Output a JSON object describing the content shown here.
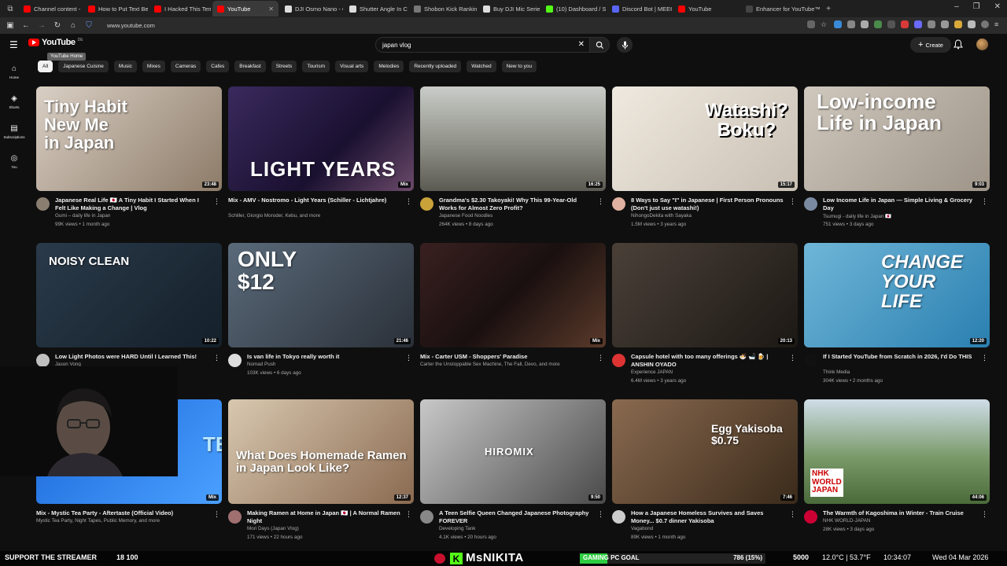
{
  "browser": {
    "tabs": [
      {
        "label": "Channel content - Y",
        "color": "#ff0000"
      },
      {
        "label": "How to Put Text Beh",
        "color": "#ff0000"
      },
      {
        "label": "I Hacked This Temu",
        "color": "#ff0000"
      },
      {
        "label": "YouTube",
        "color": "#ff0000",
        "active": true
      },
      {
        "label": "DJI Osmo Nano - Gi",
        "color": "#dddddd"
      },
      {
        "label": "Shutter Angle In Cin",
        "color": "#dddddd"
      },
      {
        "label": "Shobon Kick Ranking",
        "color": "#777777"
      },
      {
        "label": "Buy DJI Mic Series C",
        "color": "#dddddd"
      },
      {
        "label": "(10) Dashboard / Str",
        "color": "#53fc18"
      },
      {
        "label": "Discord Bot | MEE6",
        "color": "#5865f2"
      },
      {
        "label": "YouTube",
        "color": "#ff0000"
      },
      {
        "label": "Enhancer for YouTube™",
        "color": "#444444"
      }
    ],
    "url": "www.youtube.com"
  },
  "header": {
    "logo_text": "YouTube",
    "logo_cc": "DE",
    "tooltip": "YouTube Home",
    "search_value": "japan vlog",
    "create_label": "Create"
  },
  "sidebar": [
    {
      "label": "Home",
      "icon": "home-icon"
    },
    {
      "label": "Shorts",
      "icon": "shorts-icon"
    },
    {
      "label": "Subscriptions",
      "icon": "subscriptions-icon"
    },
    {
      "label": "You",
      "icon": "you-icon"
    }
  ],
  "chips": [
    "All",
    "Japanese Cuisine",
    "Music",
    "Mixes",
    "Cameras",
    "Cafes",
    "Breakfast",
    "Streets",
    "Tourism",
    "Visual arts",
    "Melodies",
    "Recently uploaded",
    "Watched",
    "New to you"
  ],
  "videos": [
    {
      "title": "Japanese Real Life 🇯🇵 A Tiny Habit I Started When I Felt Like Making a Change | Vlog",
      "channel": "Gumi – daily life in Japan",
      "stats": "99K views • 1 month ago",
      "duration": "23:48",
      "thumb_text": "Tiny Habit\nNew Me\nin Japan",
      "bg": "linear-gradient(135deg,#d9cfc4,#8d7b68)",
      "avatar": "#8a7e70"
    },
    {
      "title": "Mix - AMV - Nostromo - Light Years (Schiller - Lichtjahre)",
      "channel": "Schiller, Giorgio Moroder, Kebu, and more",
      "stats": "",
      "duration": "Mix",
      "thumb_text": "LIGHT YEARS",
      "bg": "linear-gradient(135deg,#3a2a5e,#1a1030 60%,#6b4a6a)",
      "avatar": ""
    },
    {
      "title": "Grandma's $2.30 Takoyaki! Why This 99-Year-Old Works for Almost Zero Profit?",
      "channel": "Japanese Food Noodles",
      "stats": "264K views • 8 days ago",
      "duration": "16:25",
      "thumb_text": "",
      "bg": "linear-gradient(180deg,#c9ccc8,#8a8b82 60%,#5b5a52)",
      "avatar": "#c9a23a"
    },
    {
      "title": "8 Ways to Say \"I\" in Japanese | First Person Pronouns (Don't just use watashi!)",
      "channel": "NihongoDekita with Sayaka",
      "stats": "1.5M views • 3 years ago",
      "duration": "15:17",
      "thumb_text": "Watashi?\nBoku?",
      "bg": "linear-gradient(135deg,#efe9df,#c9c0b4)",
      "avatar": "#e0b0a0"
    },
    {
      "title": "Low Income Life in Japan — Simple Living & Grocery Day",
      "channel": "Tsumugi - daily life in Japan 🇯🇵",
      "stats": "751 views • 3 days ago",
      "duration": "9:03",
      "thumb_text": "Low-income\nLife in Japan",
      "bg": "linear-gradient(135deg,#cfc8bd,#9e9488)",
      "avatar": "#7a8aa0"
    },
    {
      "title": "Low Light Photos were HARD Until I Learned This!",
      "channel": "Jason Vong",
      "stats": "",
      "duration": "10:22",
      "thumb_text": "NOISY  CLEAN",
      "bg": "linear-gradient(135deg,#2a3a4a,#14202a)",
      "avatar": "#c0c0c0"
    },
    {
      "title": "Is van life in Tokyo really worth it",
      "channel": "Nomad Push",
      "stats": "103K views • 6 days ago",
      "duration": "21:46",
      "thumb_text": "ONLY\n$12",
      "bg": "linear-gradient(135deg,#5a6a7a,#2a3038)",
      "avatar": "#dddddd"
    },
    {
      "title": "Mix - Carter USM - Shoppers' Paradise",
      "channel": "Carter the Unstoppable Sex Machine, The Fall, Devo, and more",
      "stats": "",
      "duration": "Mix",
      "thumb_text": "",
      "bg": "linear-gradient(135deg,#3a2020,#1a1010 50%,#5a3a2a)",
      "avatar": ""
    },
    {
      "title": "Capsule hotel with too many offerings 🍜 🛁 🍺 | ANSHIN OYADO",
      "channel": "Experience JAPAN",
      "stats": "6.4M views • 3 years ago",
      "duration": "20:13",
      "thumb_text": "",
      "bg": "linear-gradient(135deg,#4a4038,#1c1814)",
      "avatar": "#dd3333"
    },
    {
      "title": "If I Started YouTube from Scratch in 2026, I'd Do THIS",
      "channel": "Think Media",
      "stats": "304K views • 2 months ago",
      "duration": "12:20",
      "thumb_text": "CHANGE\nYOUR\nLIFE",
      "bg": "linear-gradient(135deg,#6fb6d8,#2a7fb0)",
      "avatar": "#111111"
    },
    {
      "title": "Mix - Mystic Tea Party - Aftertaste (Official Video)",
      "channel": "Mystic Tea Party, Night Tapes, Public Memory, and more",
      "stats": "",
      "duration": "Mix",
      "thumb_text": "TE",
      "bg": "linear-gradient(135deg,#1a66d8,#4aa0ff)",
      "avatar": ""
    },
    {
      "title": "Making Ramen at Home in Japan 🇯🇵 | A Normal Ramen Night",
      "channel": "Mori Days (Japan Vlog)",
      "stats": "171 views • 22 hours ago",
      "duration": "12:37",
      "thumb_text": "What Does Homemade Ramen\nin Japan Look Like?",
      "bg": "linear-gradient(135deg,#d8c8b0,#8a6a50)",
      "avatar": "#a07070"
    },
    {
      "title": "A Teen Selfie Queen Changed Japanese Photography FOREVER",
      "channel": "Developing Tank",
      "stats": "4.1K views • 20 hours ago",
      "duration": "9:50",
      "thumb_text": "HIROMIX",
      "bg": "linear-gradient(135deg,#c8c8c8,#4a4a4a)",
      "avatar": "#888888"
    },
    {
      "title": "How a Japanese Homeless Survives and Saves Money... $0.7 dinner Yakisoba",
      "channel": "Vagabond",
      "stats": "89K views • 1 month ago",
      "duration": "7:46",
      "thumb_text": "Egg Yakisoba\n$0.75",
      "bg": "linear-gradient(135deg,#8a6a50,#3a2a1a)",
      "avatar": "#cccccc"
    },
    {
      "title": "The Warmth of Kagoshima in Winter - Train Cruise",
      "channel": "NHK WORLD-JAPAN",
      "stats": "28K views • 3 days ago",
      "duration": "44:06",
      "thumb_text": "NHK\nWORLD\nJAPAN",
      "bg": "linear-gradient(180deg,#cfdde8,#7a9a6a 55%,#4a6a3a)",
      "avatar": "#cc0033"
    }
  ],
  "stream": {
    "support": "SUPPORT THE STREAMER",
    "counts": "18  100",
    "streamer": "MsNIKITA",
    "goal_label": "GAMING PC GOAL",
    "goal_value": "786 (15%)",
    "goal_fraction": 0.15,
    "subs": "5000",
    "weather": "12.0°C | 53.7°F",
    "time": "10:34:07",
    "date": "Wed 04 Mar 2026"
  },
  "colors": {
    "accent": "#ff0000",
    "kick_green": "#53fc18",
    "bg": "#0f0f0f"
  }
}
